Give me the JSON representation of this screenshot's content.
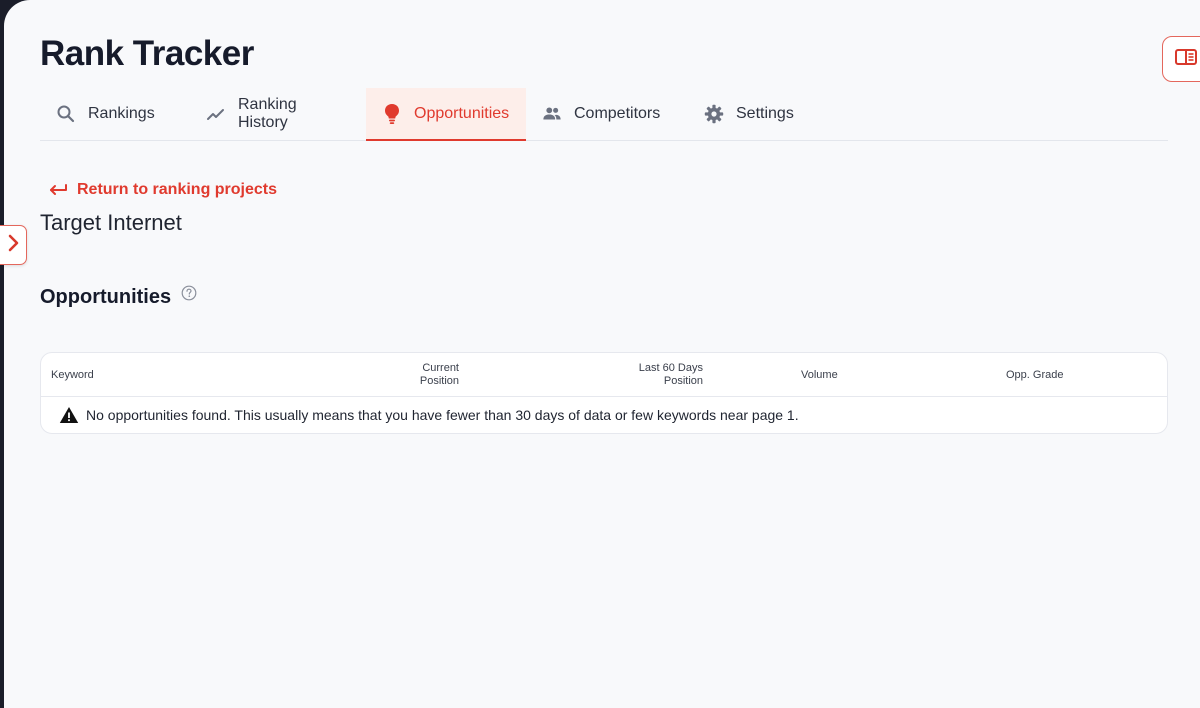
{
  "app": {
    "title": "Rank Tracker"
  },
  "icons": {
    "panel_toggle": "sidebar-panel-icon",
    "side_toggle": "chevron-right-icon",
    "help": "question-circle-icon",
    "warning": "warning-triangle-icon"
  },
  "colors": {
    "accent": "#e03a2e",
    "active_tab_bg": "#fdeeea",
    "background": "#f8f9fb"
  },
  "tabs": [
    {
      "label": "Rankings",
      "icon": "search-icon",
      "active": false
    },
    {
      "label": "Ranking History",
      "icon": "trend-line-icon",
      "active": false
    },
    {
      "label": "Opportunities",
      "icon": "lightbulb-icon",
      "active": true
    },
    {
      "label": "Competitors",
      "icon": "people-icon",
      "active": false
    },
    {
      "label": "Settings",
      "icon": "gear-icon",
      "active": false
    }
  ],
  "back_link": {
    "label": "Return to ranking projects"
  },
  "project": {
    "name": "Target Internet"
  },
  "section": {
    "title": "Opportunities"
  },
  "table": {
    "columns": {
      "keyword": "Keyword",
      "current_line1": "Current",
      "current_line2": "Position",
      "last60_line1": "Last 60 Days",
      "last60_line2": "Position",
      "volume": "Volume",
      "grade": "Opp. Grade"
    },
    "empty_message": "No opportunities found. This usually means that you have fewer than 30 days of data or few keywords near page 1."
  }
}
